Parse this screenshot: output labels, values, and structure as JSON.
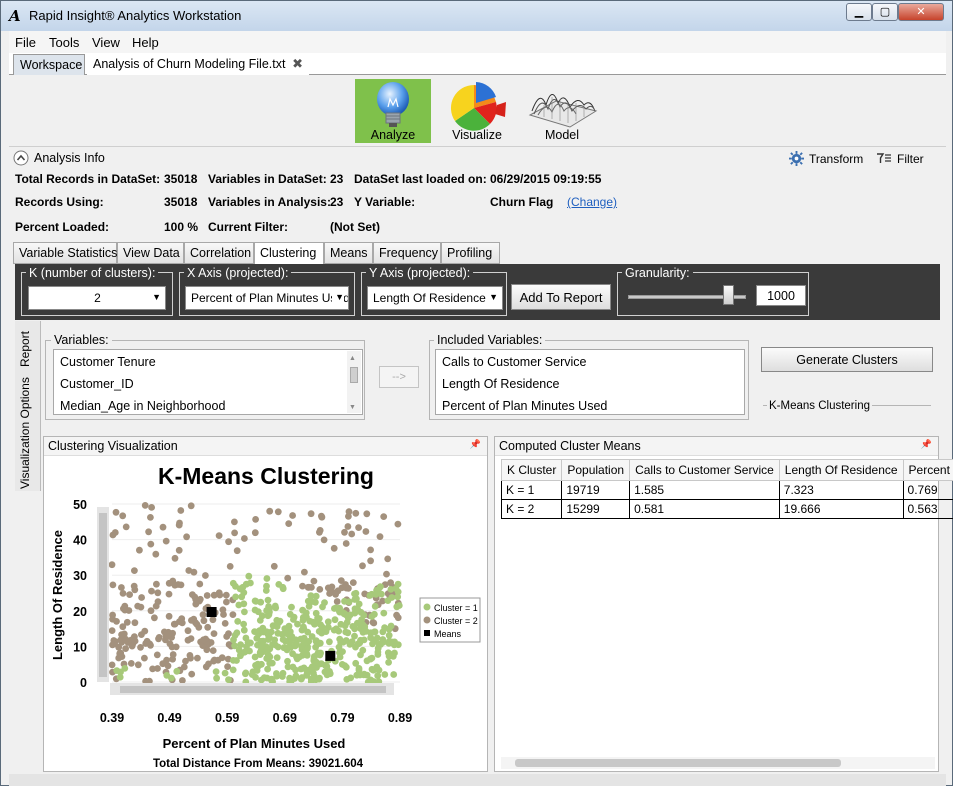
{
  "window": {
    "title": "Rapid Insight® Analytics Workstation",
    "min_glyph": "▁",
    "max_glyph": "▢",
    "close_glyph": "✕"
  },
  "menu": [
    "File",
    "Tools",
    "View",
    "Help"
  ],
  "doc_tabs": {
    "workspace": "Workspace",
    "active": "Analysis of Churn Modeling File.txt",
    "close_glyph": "✖"
  },
  "ribbon": {
    "analyze": "Analyze",
    "visualize": "Visualize",
    "model": "Model",
    "active_color": "#7fc14b"
  },
  "analysis_info": {
    "header": "Analysis Info",
    "transform": "Transform",
    "filter": "Filter",
    "total_records_label": "Total Records in DataSet:",
    "total_records": "35018",
    "records_using_label": "Records Using:",
    "records_using": "35018",
    "percent_loaded_label": "Percent Loaded:",
    "percent_loaded": "100 %",
    "vars_dataset_label": "Variables in DataSet:",
    "vars_dataset": "23",
    "vars_analysis_label": "Variables in Analysis:",
    "vars_analysis": "23",
    "current_filter_label": "Current Filter:",
    "current_filter": "(Not Set)",
    "last_loaded_label": "DataSet last loaded on:",
    "last_loaded": "06/29/2015 09:19:55",
    "y_var_label": "Y Variable:",
    "y_var": "Churn Flag",
    "change": "(Change)"
  },
  "sub_tabs": [
    "Variable Statistics",
    "View Data",
    "Correlation",
    "Clustering",
    "Means",
    "Frequency",
    "Profiling"
  ],
  "controls": {
    "k_label": "K (number of clusters):",
    "k_value": "2",
    "x_label": "X Axis (projected):",
    "x_value": "Percent of Plan Minutes Used",
    "y_label": "Y Axis (projected):",
    "y_value": "Length Of Residence",
    "add_to_report": "Add To Report",
    "granularity_label": "Granularity:",
    "granularity_value": "1000",
    "granularity_fraction": 0.85
  },
  "side_tabs": {
    "report": "Report",
    "viz_options": "Visualization Options"
  },
  "variables": {
    "title": "Variables:",
    "items": [
      "Customer Tenure",
      "Customer_ID",
      "Median_Age in Neighborhood"
    ]
  },
  "move_button": "-->",
  "included": {
    "title": "Included Variables:",
    "items": [
      "Calls to Customer Service",
      "Length Of Residence",
      "Percent of Plan Minutes Used"
    ]
  },
  "generate_clusters": "Generate Clusters",
  "kmeans_group": "K-Means Clustering",
  "viz_panel_title": "Clustering Visualization",
  "pin_glyph": "📌",
  "means_panel_title": "Computed Cluster Means",
  "means_table": {
    "headers": [
      "K Cluster",
      "Population",
      "Calls to Customer Service",
      "Length Of Residence",
      "Percent"
    ],
    "rows": [
      [
        "K = 1",
        "19719",
        "1.585",
        "7.323",
        "0.769"
      ],
      [
        "K = 2",
        "15299",
        "0.581",
        "19.666",
        "0.563"
      ]
    ]
  },
  "chart_data": {
    "type": "scatter",
    "title": "K-Means Clustering",
    "xlabel": "Percent of Plan Minutes Used",
    "ylabel": "Length Of Residence",
    "xlim": [
      0.39,
      0.89
    ],
    "ylim": [
      0,
      50
    ],
    "xticks": [
      "0.39",
      "0.49",
      "0.59",
      "0.69",
      "0.79",
      "0.89"
    ],
    "yticks": [
      "0",
      "10",
      "20",
      "30",
      "40",
      "50"
    ],
    "legend_position": "right",
    "legend": [
      "Cluster = 1",
      "Cluster = 2",
      "Means"
    ],
    "footer": "Total Distance From Means: 39021.604",
    "colors": {
      "cluster1": "#a7c97a",
      "cluster2": "#a3917d",
      "means": "#000000"
    },
    "means": [
      {
        "name": "Cluster = 1",
        "x": 0.769,
        "y": 7.323
      },
      {
        "name": "Cluster = 2",
        "x": 0.563,
        "y": 19.666
      }
    ]
  }
}
